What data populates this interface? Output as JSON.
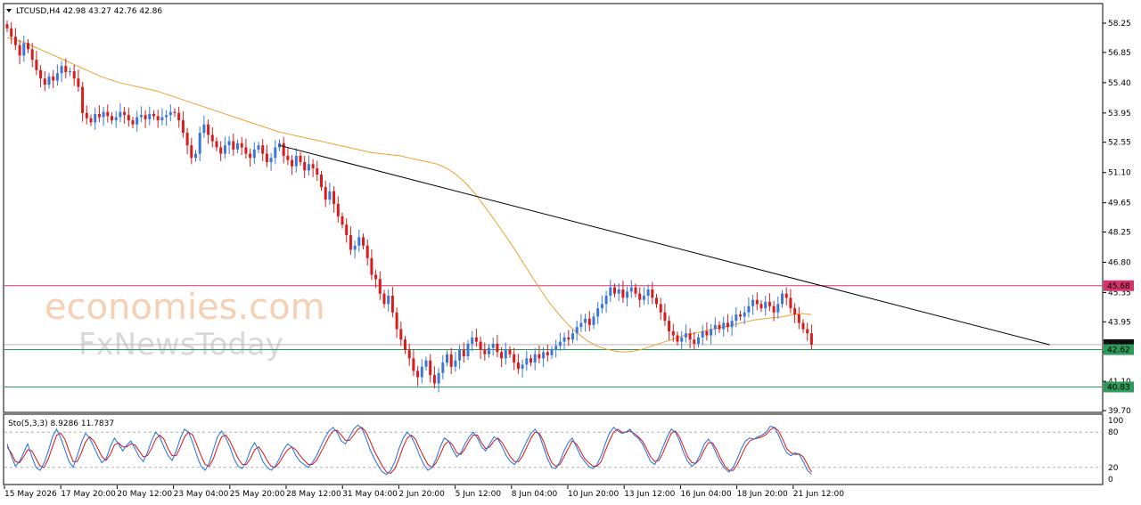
{
  "header": {
    "symbol_line": "LTCUSD,H4  42.98 43.27 42.76 42.86"
  },
  "watermark": {
    "line1": "economies.com",
    "line2": "FxNewsToday"
  },
  "stochastic": {
    "label": "Sto(5,3,3) 8.9286 11.7837",
    "ticks": [
      "100",
      "80",
      "20",
      "0"
    ],
    "k_color": "#1e6fe0",
    "d_color": "#e01010",
    "k": [
      60,
      40,
      22,
      30,
      45,
      60,
      38,
      20,
      15,
      28,
      48,
      72,
      85,
      70,
      50,
      30,
      20,
      40,
      62,
      78,
      70,
      55,
      40,
      28,
      35,
      55,
      70,
      60,
      48,
      58,
      65,
      52,
      38,
      30,
      45,
      65,
      80,
      72,
      55,
      40,
      32,
      48,
      70,
      85,
      80,
      62,
      40,
      22,
      15,
      28,
      50,
      72,
      82,
      70,
      55,
      35,
      22,
      18,
      30,
      50,
      62,
      48,
      30,
      20,
      15,
      22,
      35,
      50,
      60,
      55,
      40,
      30,
      25,
      20,
      28,
      40,
      55,
      70,
      82,
      88,
      80,
      65,
      60,
      72,
      85,
      92,
      86,
      70,
      50,
      35,
      22,
      12,
      8,
      15,
      30,
      52,
      70,
      80,
      72,
      58,
      40,
      25,
      15,
      20,
      35,
      55,
      70,
      65,
      50,
      38,
      45,
      60,
      72,
      80,
      70,
      55,
      48,
      60,
      72,
      68,
      55,
      40,
      30,
      25,
      35,
      50,
      65,
      78,
      85,
      75,
      55,
      35,
      20,
      18,
      30,
      48,
      62,
      70,
      55,
      40,
      30,
      22,
      18,
      25,
      40,
      60,
      78,
      88,
      82,
      78,
      80,
      85,
      75,
      70,
      60,
      45,
      30,
      25,
      38,
      55,
      72,
      85,
      80,
      65,
      45,
      30,
      22,
      28,
      42,
      60,
      68,
      58,
      42,
      28,
      18,
      12,
      20,
      35,
      52,
      65,
      70,
      68,
      72,
      75,
      80,
      90,
      88,
      75,
      58,
      45,
      40,
      45,
      42,
      30,
      15,
      8
    ],
    "d": [
      55,
      45,
      30,
      28,
      38,
      50,
      48,
      35,
      22,
      20,
      35,
      55,
      75,
      78,
      68,
      48,
      30,
      30,
      45,
      63,
      72,
      65,
      52,
      38,
      32,
      42,
      58,
      62,
      55,
      55,
      60,
      58,
      48,
      38,
      40,
      52,
      68,
      75,
      68,
      52,
      40,
      40,
      55,
      72,
      80,
      75,
      58,
      40,
      25,
      22,
      35,
      55,
      72,
      75,
      65,
      50,
      35,
      25,
      25,
      35,
      50,
      55,
      45,
      32,
      22,
      20,
      28,
      40,
      50,
      55,
      50,
      40,
      32,
      25,
      25,
      32,
      45,
      58,
      72,
      82,
      83,
      75,
      66,
      66,
      75,
      85,
      88,
      80,
      65,
      48,
      35,
      22,
      12,
      10,
      18,
      35,
      55,
      70,
      75,
      68,
      52,
      38,
      25,
      20,
      28,
      42,
      58,
      65,
      58,
      45,
      42,
      52,
      65,
      75,
      75,
      62,
      52,
      55,
      65,
      70,
      62,
      50,
      38,
      30,
      30,
      40,
      55,
      70,
      80,
      78,
      65,
      45,
      28,
      22,
      25,
      38,
      52,
      65,
      60,
      48,
      35,
      28,
      22,
      22,
      30,
      48,
      65,
      80,
      85,
      80,
      80,
      82,
      78,
      72,
      65,
      52,
      38,
      30,
      32,
      45,
      62,
      78,
      82,
      72,
      55,
      38,
      28,
      27,
      35,
      50,
      62,
      62,
      50,
      35,
      22,
      15,
      15,
      25,
      40,
      55,
      65,
      68,
      70,
      72,
      76,
      84,
      88,
      82,
      68,
      52,
      45,
      42,
      43,
      38,
      25,
      12
    ]
  },
  "price_axis": {
    "ticks": [
      "58.25",
      "56.85",
      "55.40",
      "53.95",
      "52.55",
      "51.10",
      "49.65",
      "48.25",
      "46.80",
      "45.35",
      "43.95",
      "42.50",
      "41.10",
      "39.70"
    ]
  },
  "levels": [
    {
      "label": "45.68",
      "color": "#d6336c"
    },
    {
      "label": "42.86",
      "color": "#111111"
    },
    {
      "label": "42.62",
      "color": "#2e9a5a"
    },
    {
      "label": "40.83",
      "color": "#2e9a5a"
    }
  ],
  "time_axis": {
    "labels": [
      "15 May 2026",
      "17 May 20:00",
      "20 May 12:00",
      "23 May 04:00",
      "25 May 20:00",
      "28 May 12:00",
      "31 May 04:00",
      "2 Jun 20:00",
      "5 Jun 12:00",
      "8 Jun 04:00",
      "10 Jun 20:00",
      "13 Jun 12:00",
      "16 Jun 04:00",
      "18 Jun 20:00",
      "21 Jun 12:00"
    ]
  },
  "chart_data": {
    "type": "candlestick",
    "symbol": "LTCUSD",
    "timeframe": "H4",
    "last_ohlc": {
      "open": 42.98,
      "high": 43.27,
      "low": 42.76,
      "close": 42.86
    },
    "up_color": "#3a78d8",
    "down_color": "#d81b1b",
    "ma_color": "#f0a030",
    "trendline_color": "#000000",
    "ylim": [
      39.7,
      58.25
    ],
    "trendline": {
      "start_index": 65,
      "start_price": 52.4,
      "end_index": 201,
      "end_price": 42.85
    },
    "closes": [
      58.0,
      57.6,
      57.2,
      56.7,
      57.3,
      57.0,
      56.5,
      56.0,
      55.6,
      55.3,
      55.7,
      55.5,
      55.85,
      56.2,
      55.9,
      55.95,
      55.6,
      55.2,
      53.95,
      53.7,
      53.5,
      53.9,
      53.75,
      54.0,
      53.8,
      53.6,
      53.75,
      54.0,
      53.85,
      53.6,
      53.4,
      53.75,
      53.85,
      53.65,
      53.9,
      53.8,
      53.6,
      53.75,
      53.85,
      54.0,
      53.95,
      53.6,
      53.0,
      52.4,
      51.8,
      52.0,
      53.0,
      53.4,
      52.9,
      52.6,
      52.3,
      52.0,
      52.4,
      52.6,
      52.2,
      52.5,
      52.3,
      52.0,
      51.8,
      52.2,
      52.4,
      52.0,
      51.6,
      51.8,
      52.3,
      52.5,
      51.9,
      51.7,
      51.4,
      51.9,
      51.6,
      51.2,
      51.5,
      51.3,
      51.0,
      50.4,
      49.8,
      50.2,
      49.6,
      49.0,
      48.6,
      48.1,
      47.4,
      47.6,
      48.0,
      47.6,
      47.0,
      46.2,
      46.0,
      45.3,
      44.8,
      45.2,
      44.4,
      43.6,
      43.1,
      42.6,
      42.2,
      41.6,
      41.3,
      41.8,
      42.1,
      41.4,
      41.0,
      41.5,
      42.0,
      42.4,
      41.8,
      42.1,
      42.6,
      42.3,
      42.9,
      43.2,
      43.0,
      42.6,
      42.4,
      42.7,
      42.9,
      42.5,
      42.2,
      42.6,
      42.4,
      42.0,
      41.7,
      41.9,
      42.2,
      42.0,
      42.4,
      42.2,
      42.5,
      42.35,
      42.6,
      42.8,
      43.0,
      43.2,
      43.1,
      43.4,
      43.7,
      43.9,
      44.1,
      43.8,
      44.2,
      44.6,
      44.8,
      45.2,
      45.6,
      45.3,
      45.5,
      45.1,
      45.4,
      45.6,
      45.3,
      45.0,
      45.2,
      45.5,
      45.1,
      44.8,
      44.4,
      44.0,
      43.5,
      43.3,
      43.0,
      43.2,
      43.4,
      43.1,
      42.9,
      43.2,
      43.5,
      43.3,
      43.6,
      43.8,
      43.6,
      43.9,
      43.7,
      44.0,
      44.3,
      44.2,
      44.4,
      44.7,
      45.0,
      44.8,
      44.6,
      44.9,
      44.7,
      44.4,
      44.8,
      45.3,
      45.1,
      44.6,
      44.3,
      43.9,
      43.6,
      43.4,
      42.86
    ],
    "ma": [
      57.55,
      57.45,
      57.3,
      57.1,
      56.9,
      56.7,
      56.5,
      56.3,
      56.1,
      55.9,
      55.7,
      55.55,
      55.4,
      55.3,
      55.2,
      55.1,
      55.0,
      54.85,
      54.7,
      54.55,
      54.4,
      54.25,
      54.1,
      53.95,
      53.8,
      53.65,
      53.5,
      53.35,
      53.2,
      53.05,
      52.95,
      52.85,
      52.75,
      52.65,
      52.55,
      52.45,
      52.35,
      52.25,
      52.15,
      52.05,
      52.0,
      51.95,
      51.9,
      51.8,
      51.7,
      51.6,
      51.5,
      51.3,
      51.0,
      50.6,
      50.1,
      49.5,
      48.9,
      48.25,
      47.6,
      46.9,
      46.2,
      45.5,
      44.85,
      44.3,
      43.8,
      43.4,
      43.05,
      42.8,
      42.65,
      42.55,
      42.5,
      42.55,
      42.65,
      42.8,
      42.95,
      43.1,
      43.25,
      43.35,
      43.45,
      43.55,
      43.65,
      43.75,
      43.85,
      43.95,
      44.05,
      44.1,
      44.15,
      44.2,
      44.3,
      44.35,
      44.3
    ]
  }
}
